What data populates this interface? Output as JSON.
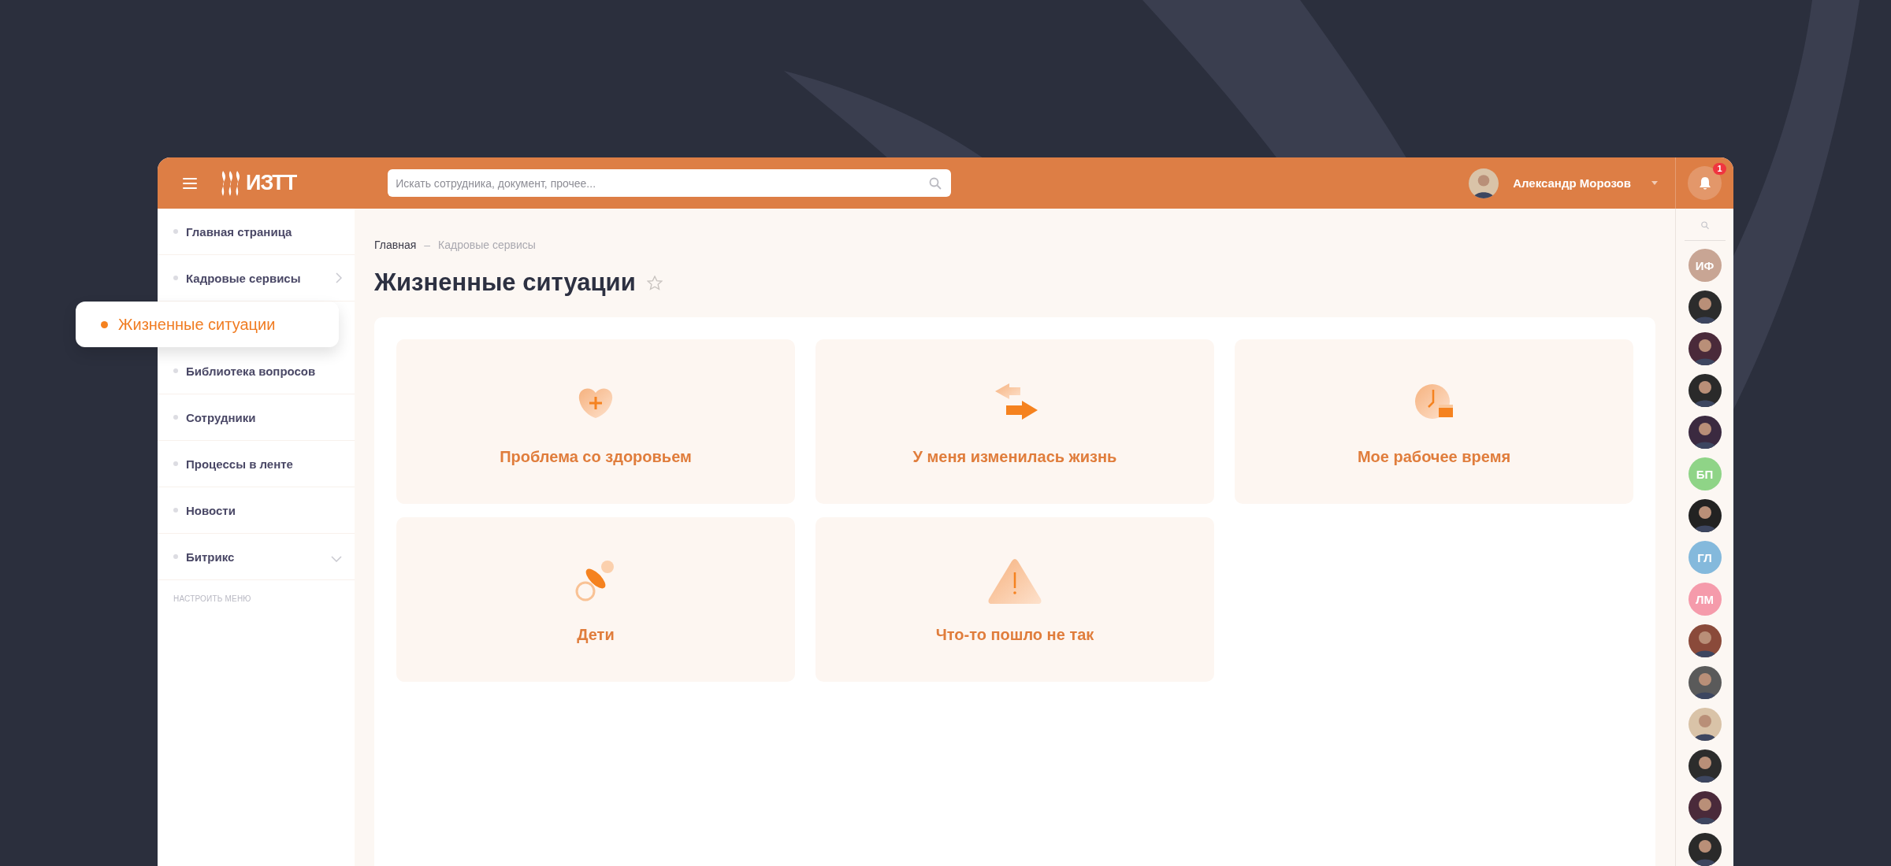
{
  "header": {
    "logo": "ИЗТТ",
    "search": {
      "placeholder": "Искать сотрудника, документ, прочее..."
    },
    "user": {
      "name": "Александр Морозов"
    },
    "notifications": {
      "count": "1"
    }
  },
  "sidebar": {
    "items": [
      {
        "label": "Главная страница",
        "selected": false,
        "expandable": false
      },
      {
        "label": "Кадровые сервисы",
        "selected": false,
        "expandable": true,
        "expanded": false
      },
      {
        "label": "Жизненные ситуации",
        "selected": true,
        "expandable": false
      },
      {
        "label": "Библиотека вопросов",
        "selected": false,
        "expandable": false
      },
      {
        "label": "Сотрудники",
        "selected": false,
        "expandable": false
      },
      {
        "label": "Процессы в ленте",
        "selected": false,
        "expandable": false
      },
      {
        "label": "Новости",
        "selected": false,
        "expandable": false
      },
      {
        "label": "Битрикс",
        "selected": false,
        "expandable": true,
        "expanded": true
      }
    ],
    "configure": "НАСТРОИТЬ МЕНЮ"
  },
  "breadcrumbs": {
    "items": [
      "Главная",
      "Кадровые сервисы"
    ],
    "separator": "–"
  },
  "page": {
    "title": "Жизненные ситуации",
    "favorite": false
  },
  "cards": [
    {
      "title": "Проблема со здоровьем",
      "kind": "health"
    },
    {
      "title": "У меня изменилась жизнь",
      "kind": "change"
    },
    {
      "title": "Мое рабочее время",
      "kind": "time"
    },
    {
      "title": "Дети",
      "kind": "children"
    },
    {
      "title": "Что-то пошло не так",
      "kind": "warning"
    }
  ],
  "contacts": [
    {
      "kind": "initials",
      "initials": "ИФ",
      "color": "#c8a594"
    },
    {
      "kind": "photo"
    },
    {
      "kind": "photo"
    },
    {
      "kind": "photo"
    },
    {
      "kind": "photo"
    },
    {
      "kind": "initials",
      "initials": "БП",
      "color": "#8fd487"
    },
    {
      "kind": "photo"
    },
    {
      "kind": "initials",
      "initials": "ГЛ",
      "color": "#84b9dc"
    },
    {
      "kind": "initials",
      "initials": "ЛМ",
      "color": "#f59bab"
    },
    {
      "kind": "photo"
    },
    {
      "kind": "photo"
    },
    {
      "kind": "photo"
    },
    {
      "kind": "photo"
    },
    {
      "kind": "photo"
    },
    {
      "kind": "photo"
    }
  ]
}
